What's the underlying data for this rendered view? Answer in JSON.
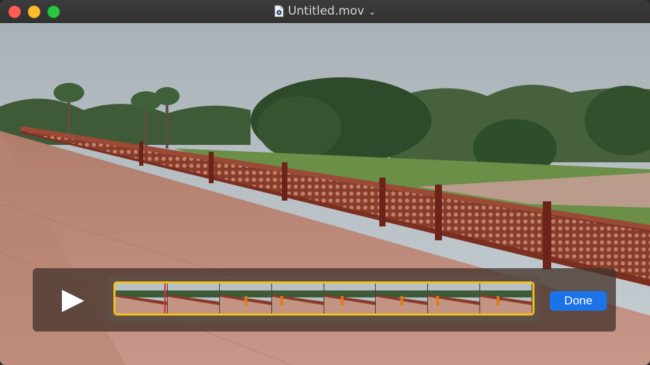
{
  "window": {
    "title": "Untitled.mov"
  },
  "trim": {
    "done_label": "Done",
    "frame_count": 8
  },
  "icons": {
    "document": "quicktime-document-icon",
    "play": "play-icon",
    "chevron": "chevron-down-icon"
  },
  "colors": {
    "trim_handles": "#f3c21a",
    "playhead": "#e8242c",
    "done_button": "#1a73e8"
  }
}
